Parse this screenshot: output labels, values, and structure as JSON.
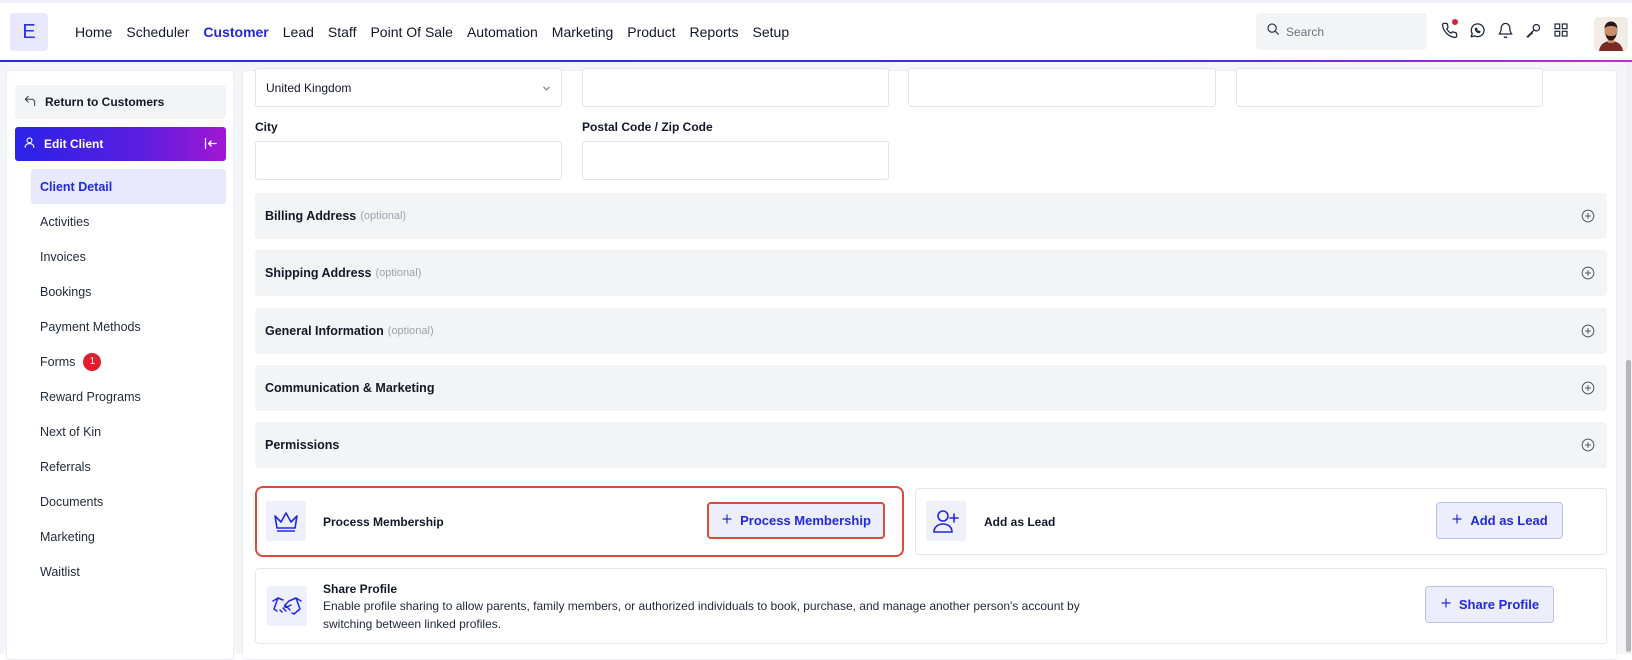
{
  "brand": {
    "logo_letter": "E"
  },
  "nav": {
    "items": [
      {
        "label": "Home",
        "active": false
      },
      {
        "label": "Scheduler",
        "active": false
      },
      {
        "label": "Customer",
        "active": true
      },
      {
        "label": "Lead",
        "active": false
      },
      {
        "label": "Staff",
        "active": false
      },
      {
        "label": "Point Of Sale",
        "active": false
      },
      {
        "label": "Automation",
        "active": false
      },
      {
        "label": "Marketing",
        "active": false
      },
      {
        "label": "Product",
        "active": false
      },
      {
        "label": "Reports",
        "active": false
      },
      {
        "label": "Setup",
        "active": false
      }
    ]
  },
  "search": {
    "placeholder": "Search"
  },
  "top_icons": [
    "phone-icon",
    "whatsapp-icon",
    "bell-icon",
    "key-icon",
    "grid-icon"
  ],
  "colors": {
    "accent": "#2128e0",
    "highlight": "#dc4a3a",
    "badge": "#e11d2e"
  },
  "sidebar": {
    "return_label": "Return to Customers",
    "edit_client_label": "Edit Client",
    "items": [
      {
        "label": "Client Detail",
        "active": true
      },
      {
        "label": "Activities"
      },
      {
        "label": "Invoices"
      },
      {
        "label": "Bookings"
      },
      {
        "label": "Payment Methods"
      },
      {
        "label": "Forms",
        "badge": "1"
      },
      {
        "label": "Reward Programs"
      },
      {
        "label": "Next of Kin"
      },
      {
        "label": "Referrals"
      },
      {
        "label": "Documents"
      },
      {
        "label": "Marketing"
      },
      {
        "label": "Waitlist"
      }
    ]
  },
  "address": {
    "country_value": "United Kingdom",
    "city_label": "City",
    "postal_label": "Postal Code / Zip Code"
  },
  "sections": [
    {
      "title": "Billing Address",
      "optional": "(optional)"
    },
    {
      "title": "Shipping Address",
      "optional": "(optional)"
    },
    {
      "title": "General Information",
      "optional": "(optional)"
    },
    {
      "title": "Communication & Marketing",
      "optional": ""
    },
    {
      "title": "Permissions",
      "optional": ""
    }
  ],
  "membership": {
    "title": "Process Membership",
    "button": "Process Membership"
  },
  "lead": {
    "title": "Add as Lead",
    "button": "Add as Lead"
  },
  "share": {
    "title": "Share Profile",
    "description": "Enable profile sharing to allow parents, family members, or authorized individuals to book, purchase, and manage another person's account by switching between linked profiles.",
    "button": "Share Profile"
  }
}
